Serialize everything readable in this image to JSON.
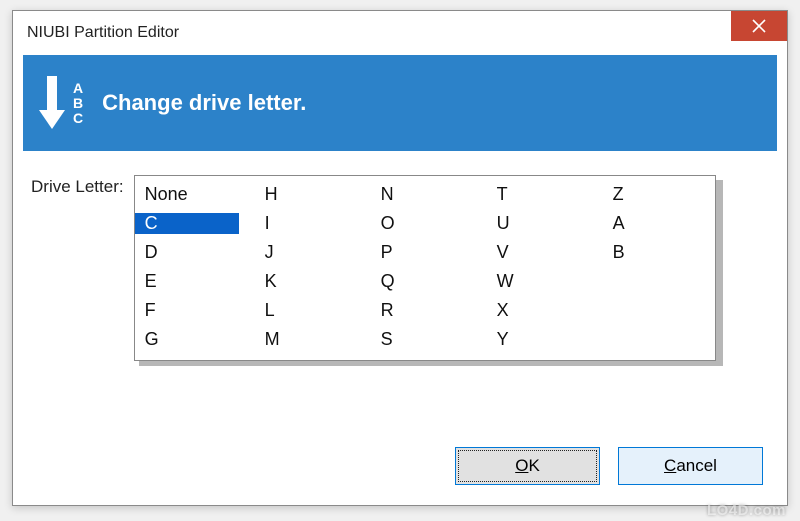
{
  "window": {
    "title": "NIUBI Partition Editor"
  },
  "banner": {
    "letters": {
      "a": "A",
      "b": "B",
      "c": "C"
    },
    "title": "Change drive letter."
  },
  "content": {
    "label": "Drive Letter:",
    "selected": "C",
    "options": [
      "None",
      "H",
      "N",
      "T",
      "Z",
      "C",
      "I",
      "O",
      "U",
      "A",
      "D",
      "J",
      "P",
      "V",
      "B",
      "E",
      "K",
      "Q",
      "W",
      "",
      "F",
      "L",
      "R",
      "X",
      "",
      "G",
      "M",
      "S",
      "Y",
      ""
    ]
  },
  "buttons": {
    "ok": "OK",
    "cancel": "Cancel"
  },
  "watermark": "LO4D.com"
}
